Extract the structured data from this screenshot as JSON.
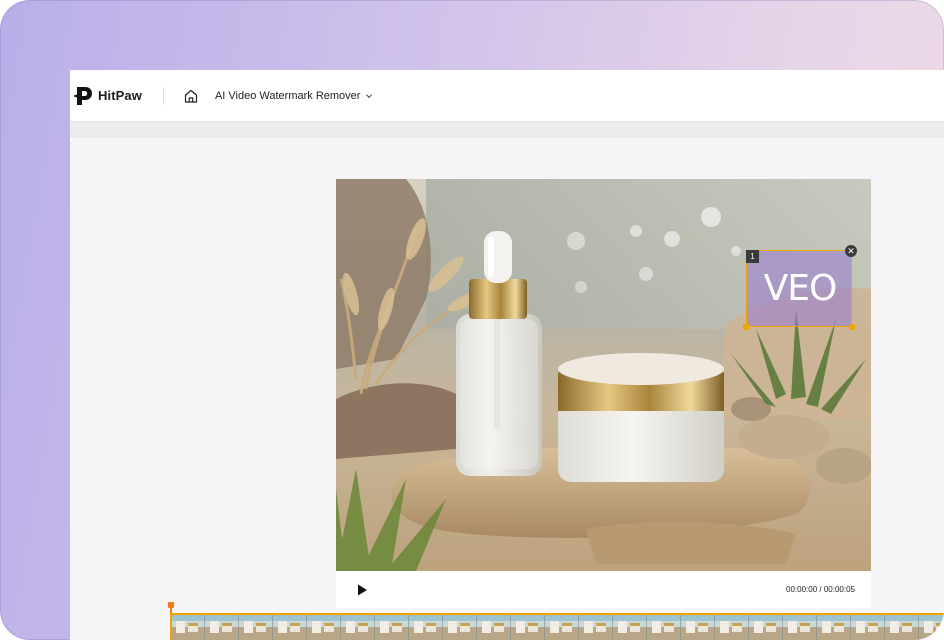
{
  "header": {
    "brand": "HitPaw",
    "product_menu_label": "AI Video Watermark Remover"
  },
  "icons": {
    "logo": "hitpaw-logo-icon",
    "home": "home-icon",
    "dropdown": "chevron-down-icon",
    "play": "play-icon",
    "close": "close-icon"
  },
  "player": {
    "current_time": "00:00:00",
    "separator": "/",
    "total_time": "00:00:05"
  },
  "watermark_selection": {
    "index": "1",
    "detected_text": "VEO"
  },
  "colors": {
    "selection_border": "#f0a500",
    "selection_fill": "#9678d2",
    "playhead": "#f07a1a"
  }
}
